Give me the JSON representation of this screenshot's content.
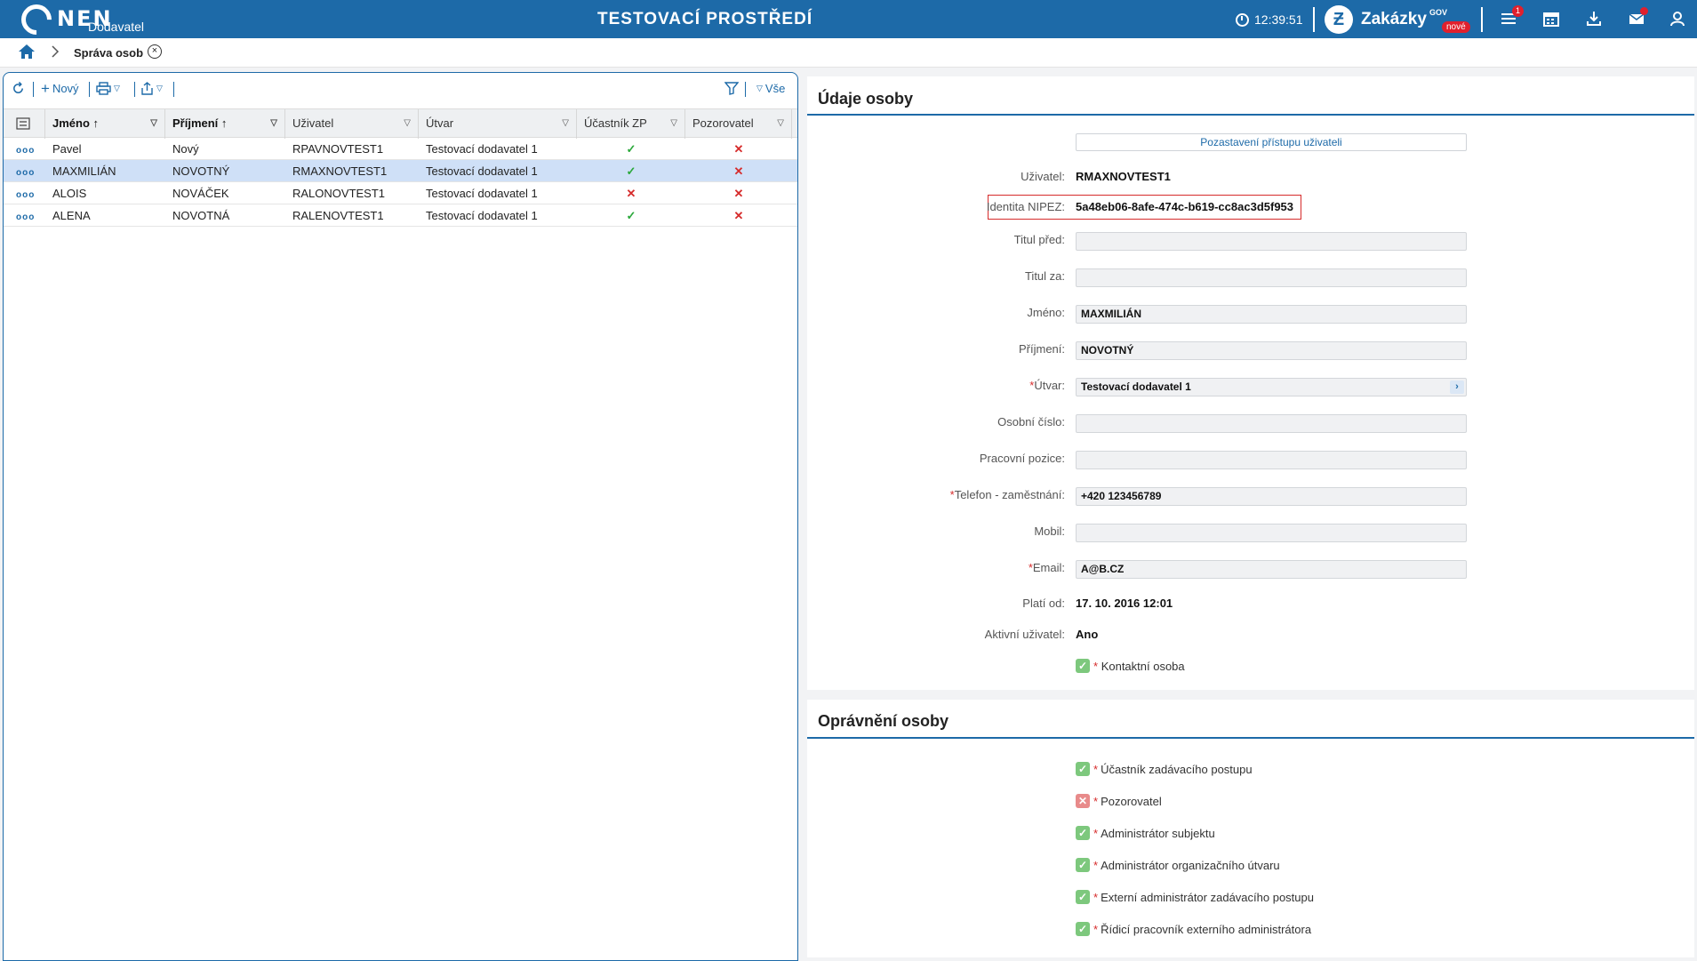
{
  "header": {
    "logo_text": "NEN",
    "logo_sub": "Dodavatel",
    "env_title": "TESTOVACÍ PROSTŘEDÍ",
    "time": "12:39:51",
    "zakazky_label": "Zakázky",
    "zakazky_gov": "GOV",
    "zakazky_new": "nové",
    "menu_badge": "1"
  },
  "breadcrumb": {
    "current": "Správa osob"
  },
  "toolbar": {
    "new_label": "Nový",
    "all_label": "Vše"
  },
  "grid": {
    "columns": [
      "Jméno",
      "Příjmení",
      "Uživatel",
      "Útvar",
      "Účastník ZP",
      "Pozorovatel"
    ],
    "rows": [
      {
        "jmeno": "Pavel",
        "prijmeni": "Nový",
        "uzivatel": "RPAVNOVTEST1",
        "utvar": "Testovací dodavatel 1",
        "ucastnik": true,
        "pozorovatel": false,
        "selected": false
      },
      {
        "jmeno": "MAXMILIÁN",
        "prijmeni": "NOVOTNÝ",
        "uzivatel": "RMAXNOVTEST1",
        "utvar": "Testovací dodavatel 1",
        "ucastnik": true,
        "pozorovatel": false,
        "selected": true
      },
      {
        "jmeno": "ALOIS",
        "prijmeni": "NOVÁČEK",
        "uzivatel": "RALONOVTEST1",
        "utvar": "Testovací dodavatel 1",
        "ucastnik": false,
        "pozorovatel": false,
        "selected": false
      },
      {
        "jmeno": "ALENA",
        "prijmeni": "NOVOTNÁ",
        "uzivatel": "RALENOVTEST1",
        "utvar": "Testovací dodavatel 1",
        "ucastnik": true,
        "pozorovatel": false,
        "selected": false
      }
    ]
  },
  "detail": {
    "title": "Údaje osoby",
    "pause_button": "Pozastavení přístupu uživateli",
    "labels": {
      "uzivatel": "Uživatel:",
      "identita": "Identita NIPEZ:",
      "titul_pred": "Titul před:",
      "titul_za": "Titul za:",
      "jmeno": "Jméno:",
      "prijmeni": "Příjmení:",
      "utvar": "Útvar:",
      "osobni_cislo": "Osobní číslo:",
      "pracovni_pozice": "Pracovní pozice:",
      "telefon": "Telefon - zaměstnání:",
      "mobil": "Mobil:",
      "email": "Email:",
      "plati_od": "Platí od:",
      "aktivni": "Aktivní uživatel:",
      "kontaktni": "Kontaktní osoba"
    },
    "values": {
      "uzivatel": "RMAXNOVTEST1",
      "identita": "5a48eb06-8afe-474c-b619-cc8ac3d5f953",
      "titul_pred": "",
      "titul_za": "",
      "jmeno": "MAXMILIÁN",
      "prijmeni": "NOVOTNÝ",
      "utvar": "Testovací dodavatel 1",
      "osobni_cislo": "",
      "pracovni_pozice": "",
      "telefon": "+420 123456789",
      "mobil": "",
      "email": "A@B.CZ",
      "plati_od": "17. 10. 2016 12:01",
      "aktivni": "Ano"
    }
  },
  "permissions": {
    "title": "Oprávnění osoby",
    "items": [
      {
        "label": "Účastník zadávacího postupu",
        "checked": true
      },
      {
        "label": "Pozorovatel",
        "checked": false
      },
      {
        "label": "Administrátor subjektu",
        "checked": true
      },
      {
        "label": "Administrátor organizačního útvaru",
        "checked": true
      },
      {
        "label": "Externí administrátor zadávacího postupu",
        "checked": true
      },
      {
        "label": "Řídicí pracovník externího administrátora",
        "checked": true
      }
    ]
  },
  "colors": {
    "brand": "#1d6aa8",
    "ok": "#2aa83a",
    "error": "#d62b2b",
    "selected_row": "#cfe0f7"
  }
}
